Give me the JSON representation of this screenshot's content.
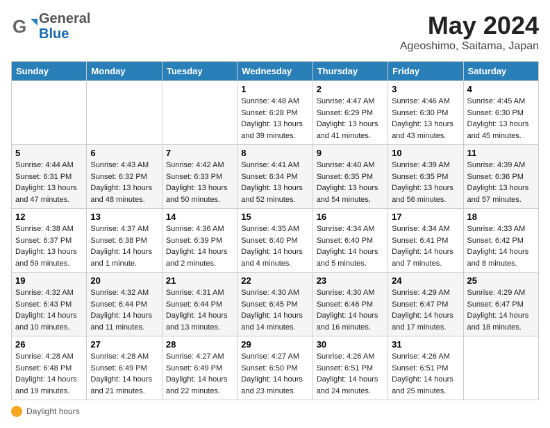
{
  "header": {
    "logo_general": "General",
    "logo_blue": "Blue",
    "title": "May 2024",
    "subtitle": "Ageoshimo, Saitama, Japan"
  },
  "calendar": {
    "days_of_week": [
      "Sunday",
      "Monday",
      "Tuesday",
      "Wednesday",
      "Thursday",
      "Friday",
      "Saturday"
    ],
    "weeks": [
      [
        {
          "num": "",
          "info": ""
        },
        {
          "num": "",
          "info": ""
        },
        {
          "num": "",
          "info": ""
        },
        {
          "num": "1",
          "info": "Sunrise: 4:48 AM\nSunset: 6:28 PM\nDaylight: 13 hours\nand 39 minutes."
        },
        {
          "num": "2",
          "info": "Sunrise: 4:47 AM\nSunset: 6:29 PM\nDaylight: 13 hours\nand 41 minutes."
        },
        {
          "num": "3",
          "info": "Sunrise: 4:46 AM\nSunset: 6:30 PM\nDaylight: 13 hours\nand 43 minutes."
        },
        {
          "num": "4",
          "info": "Sunrise: 4:45 AM\nSunset: 6:30 PM\nDaylight: 13 hours\nand 45 minutes."
        }
      ],
      [
        {
          "num": "5",
          "info": "Sunrise: 4:44 AM\nSunset: 6:31 PM\nDaylight: 13 hours\nand 47 minutes."
        },
        {
          "num": "6",
          "info": "Sunrise: 4:43 AM\nSunset: 6:32 PM\nDaylight: 13 hours\nand 48 minutes."
        },
        {
          "num": "7",
          "info": "Sunrise: 4:42 AM\nSunset: 6:33 PM\nDaylight: 13 hours\nand 50 minutes."
        },
        {
          "num": "8",
          "info": "Sunrise: 4:41 AM\nSunset: 6:34 PM\nDaylight: 13 hours\nand 52 minutes."
        },
        {
          "num": "9",
          "info": "Sunrise: 4:40 AM\nSunset: 6:35 PM\nDaylight: 13 hours\nand 54 minutes."
        },
        {
          "num": "10",
          "info": "Sunrise: 4:39 AM\nSunset: 6:35 PM\nDaylight: 13 hours\nand 56 minutes."
        },
        {
          "num": "11",
          "info": "Sunrise: 4:39 AM\nSunset: 6:36 PM\nDaylight: 13 hours\nand 57 minutes."
        }
      ],
      [
        {
          "num": "12",
          "info": "Sunrise: 4:38 AM\nSunset: 6:37 PM\nDaylight: 13 hours\nand 59 minutes."
        },
        {
          "num": "13",
          "info": "Sunrise: 4:37 AM\nSunset: 6:38 PM\nDaylight: 14 hours\nand 1 minute."
        },
        {
          "num": "14",
          "info": "Sunrise: 4:36 AM\nSunset: 6:39 PM\nDaylight: 14 hours\nand 2 minutes."
        },
        {
          "num": "15",
          "info": "Sunrise: 4:35 AM\nSunset: 6:40 PM\nDaylight: 14 hours\nand 4 minutes."
        },
        {
          "num": "16",
          "info": "Sunrise: 4:34 AM\nSunset: 6:40 PM\nDaylight: 14 hours\nand 5 minutes."
        },
        {
          "num": "17",
          "info": "Sunrise: 4:34 AM\nSunset: 6:41 PM\nDaylight: 14 hours\nand 7 minutes."
        },
        {
          "num": "18",
          "info": "Sunrise: 4:33 AM\nSunset: 6:42 PM\nDaylight: 14 hours\nand 8 minutes."
        }
      ],
      [
        {
          "num": "19",
          "info": "Sunrise: 4:32 AM\nSunset: 6:43 PM\nDaylight: 14 hours\nand 10 minutes."
        },
        {
          "num": "20",
          "info": "Sunrise: 4:32 AM\nSunset: 6:44 PM\nDaylight: 14 hours\nand 11 minutes."
        },
        {
          "num": "21",
          "info": "Sunrise: 4:31 AM\nSunset: 6:44 PM\nDaylight: 14 hours\nand 13 minutes."
        },
        {
          "num": "22",
          "info": "Sunrise: 4:30 AM\nSunset: 6:45 PM\nDaylight: 14 hours\nand 14 minutes."
        },
        {
          "num": "23",
          "info": "Sunrise: 4:30 AM\nSunset: 6:46 PM\nDaylight: 14 hours\nand 16 minutes."
        },
        {
          "num": "24",
          "info": "Sunrise: 4:29 AM\nSunset: 6:47 PM\nDaylight: 14 hours\nand 17 minutes."
        },
        {
          "num": "25",
          "info": "Sunrise: 4:29 AM\nSunset: 6:47 PM\nDaylight: 14 hours\nand 18 minutes."
        }
      ],
      [
        {
          "num": "26",
          "info": "Sunrise: 4:28 AM\nSunset: 6:48 PM\nDaylight: 14 hours\nand 19 minutes."
        },
        {
          "num": "27",
          "info": "Sunrise: 4:28 AM\nSunset: 6:49 PM\nDaylight: 14 hours\nand 21 minutes."
        },
        {
          "num": "28",
          "info": "Sunrise: 4:27 AM\nSunset: 6:49 PM\nDaylight: 14 hours\nand 22 minutes."
        },
        {
          "num": "29",
          "info": "Sunrise: 4:27 AM\nSunset: 6:50 PM\nDaylight: 14 hours\nand 23 minutes."
        },
        {
          "num": "30",
          "info": "Sunrise: 4:26 AM\nSunset: 6:51 PM\nDaylight: 14 hours\nand 24 minutes."
        },
        {
          "num": "31",
          "info": "Sunrise: 4:26 AM\nSunset: 6:51 PM\nDaylight: 14 hours\nand 25 minutes."
        },
        {
          "num": "",
          "info": ""
        }
      ]
    ]
  },
  "footer": {
    "daylight_label": "Daylight hours"
  }
}
